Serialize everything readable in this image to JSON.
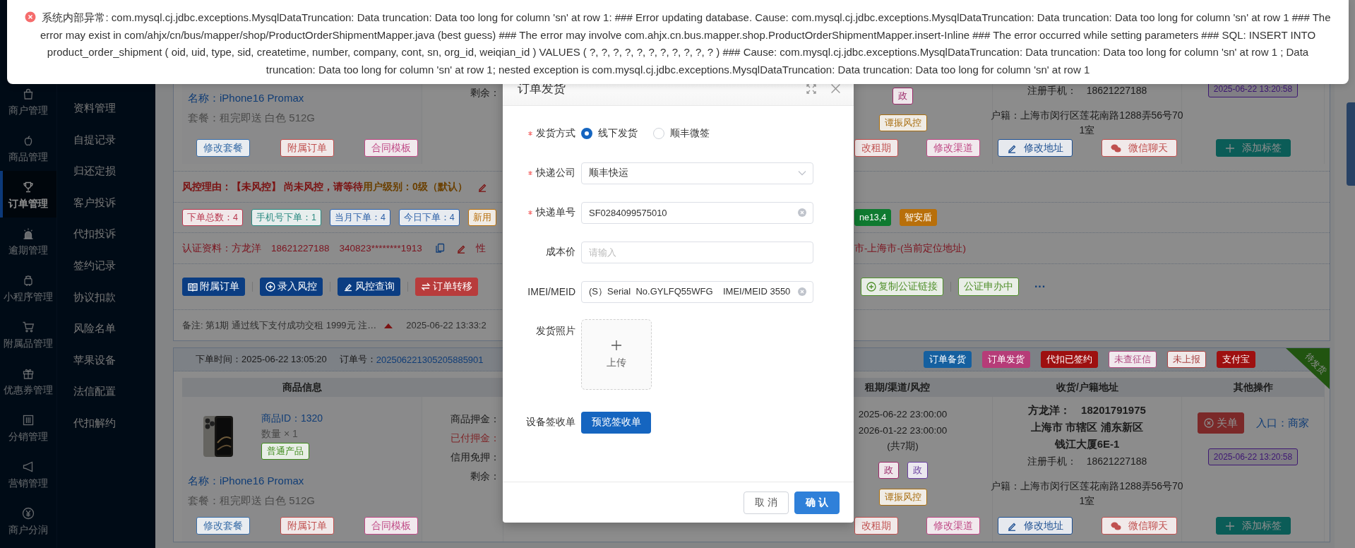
{
  "toast": {
    "kind": "error",
    "message": "系统内部异常: com.mysql.cj.jdbc.exceptions.MysqlDataTruncation: Data truncation: Data too long for column 'sn' at row 1: ### Error updating database. Cause: com.mysql.cj.jdbc.exceptions.MysqlDataTruncation: Data truncation: Data too long for column 'sn' at row 1 ### The error may exist in com/ahjx/cn/bus/mapper/shop/ProductOrderShipmentMapper.java (best guess) ### The error may involve com.ahjx.cn.bus.mapper.shop.ProductOrderShipmentMapper.insert-Inline ### The error occurred while setting parameters ### SQL: INSERT INTO product_order_shipment ( oid, uid, type, sid, createtime, number, company, cont, sn, org_id, weiqian_id ) VALUES ( ?, ?, ?, ?, ?, ?, ?, ?, ?, ?, ? ) ### Cause: com.mysql.cj.jdbc.exceptions.MysqlDataTruncation: Data truncation: Data too long for column 'sn' at row 1 ; Data truncation: Data too long for column 'sn' at row 1; nested exception is com.mysql.cj.jdbc.exceptions.MysqlDataTruncation: Data truncation: Data too long for column 'sn' at row 1"
  },
  "nav": [
    {
      "label": "商户管理",
      "selected": false
    },
    {
      "label": "商品管理",
      "selected": false
    },
    {
      "label": "订单管理",
      "selected": true
    },
    {
      "label": "逾期管理",
      "selected": false
    },
    {
      "label": "小程序管理",
      "selected": false
    },
    {
      "label": "附属品管理",
      "selected": false
    },
    {
      "label": "优惠券管理",
      "selected": false
    },
    {
      "label": "分销管理",
      "selected": false
    },
    {
      "label": "营销管理",
      "selected": false
    },
    {
      "label": "商户分润",
      "selected": false
    }
  ],
  "submenu": [
    "资料管理",
    "自提记录",
    "归还定损",
    "客户投诉",
    "代扣投诉",
    "签约记录",
    "协议扣款",
    "风险名单",
    "苹果设备",
    "法信配置",
    "代扣解约"
  ],
  "orders": [
    {
      "body": {
        "product": {
          "name": "名称：iPhone16 Promax",
          "package": "套餐：租完即送 白色 512G",
          "buttons": [
            {
              "label": "修改套餐",
              "color": "#3a6ea8"
            },
            {
              "label": "附属订单",
              "color": "#c0504f"
            },
            {
              "label": "合同模板",
              "color": "#c04a86"
            }
          ]
        },
        "deposit": [
          {
            "label": "剩余：",
            "kind": "normal"
          }
        ],
        "lease": {
          "tags": [
            {
              "label": "政",
              "color": "#9c2a6a"
            }
          ],
          "risk_tag": {
            "label": "谭振风控",
            "color": "#a86e10"
          },
          "buttons": [
            {
              "label": "改租期",
              "color": "#c0504f"
            },
            {
              "label": "修改渠道",
              "color": "#c04a86"
            }
          ]
        },
        "address": {
          "phone": "注册手机：　18621227188",
          "household": [
            "户籍：上海市闵行区莲花南路1288弄56号70",
            "1室"
          ],
          "buttons": [
            {
              "label": "修改地址",
              "color": "#1d4f91"
            },
            {
              "label": "微信聊天",
              "color": "#c0504f"
            }
          ]
        },
        "ops": {
          "stamp": "2025-06-22 13:20:58",
          "button": "添加标签"
        }
      },
      "risk": {
        "reason": "风控理由：【未风控】 尚未风控，请等待",
        "level": "用户级别：0级（默认）"
      },
      "stats": [
        {
          "label": "下单总数：4",
          "color": "#b8384f"
        },
        {
          "label": "手机号下单：1",
          "color": "#2a8a80"
        },
        {
          "label": "当月下单：4",
          "color": "#2f62a8"
        },
        {
          "label": "今日下单：4",
          "color": "#2f62a8"
        },
        {
          "label": "新用",
          "color": "#b8700e"
        }
      ],
      "stats_right": [
        {
          "label": "ne13,4",
          "color": "#0f7a30",
          "kind": "solid"
        },
        {
          "label": "智安盾",
          "color": "#b86f0a",
          "kind": "solid"
        }
      ],
      "identity": {
        "text": "认证资料：方龙洋　18621227188　340823********1913",
        "cut": "性",
        "location": "市-上海市-(当前定位地址)"
      },
      "actions": [
        {
          "label": "附属订单",
          "kind": "solid",
          "color": "#0b3d82"
        },
        {
          "label": "录入风控",
          "kind": "solid",
          "color": "#0b3d82"
        },
        {
          "label": "风控查询",
          "kind": "solid",
          "color": "#0b3d82"
        },
        {
          "label": "订单转移",
          "kind": "solid",
          "color": "#b83c3c"
        }
      ],
      "actions_right": [
        {
          "label": "复制公证链接",
          "color": "#4f8f2a"
        },
        {
          "label": "公证申办中",
          "color": "#4f8f2a"
        }
      ],
      "more": "···",
      "note": {
        "text": "备注: 第1期 通过线下支付成功交租 1999元 注…",
        "time": "2025-06-22 13:33:2"
      }
    },
    {
      "header": {
        "placed": "下单时间：2025-06-22 13:05:20",
        "order_no_label": "订单号：",
        "order_no": "202506221305205885901",
        "ribbon": "待发货",
        "tags": [
          {
            "label": "订单备货",
            "kind": "solid",
            "color": "#1560a0"
          },
          {
            "label": "订单发货",
            "kind": "solid",
            "color": "#b63c78"
          },
          {
            "label": "代扣已签约",
            "kind": "solid",
            "color": "#9e1010"
          },
          {
            "label": "未查征信",
            "kind": "outline",
            "color": "#b04a80"
          },
          {
            "label": "未上报",
            "kind": "outline",
            "color": "#a84040"
          },
          {
            "label": "支付宝",
            "kind": "solid",
            "color": "#9e1010"
          }
        ]
      },
      "columns": [
        "商品信息",
        "租期/渠道/风控",
        "收货/户籍地址",
        "其他操作"
      ],
      "body": {
        "product": {
          "id": "商品ID：1320",
          "quantity": "数量 × 1",
          "type_tag": {
            "label": "普通产品",
            "color": "#3d8a1a"
          },
          "name": "名称：iPhone16 Promax",
          "package": "套餐：租完即送 白色 512G",
          "buttons": [
            {
              "label": "修改套餐",
              "color": "#3a6ea8"
            },
            {
              "label": "附属订单",
              "color": "#c0504f"
            },
            {
              "label": "合同模板",
              "color": "#c04a86"
            }
          ]
        },
        "deposit": [
          {
            "label": "商品押金：",
            "kind": "normal"
          },
          {
            "label": "已付押金：",
            "kind": "paid"
          },
          {
            "label": "信用免押：",
            "kind": "normal"
          },
          {
            "label": "剩余：",
            "kind": "normal"
          }
        ],
        "lease": {
          "dates": [
            "2025-06-22 23:00:00",
            "2026-01-22 23:00:00",
            "(共7期)"
          ],
          "tags": [
            {
              "label": "政",
              "color": "#9c2a6a"
            },
            {
              "label": "政",
              "color": "#6a3fa0"
            }
          ],
          "risk_tag": {
            "label": "谭振风控",
            "color": "#a86e10"
          },
          "buttons": [
            {
              "label": "改租期",
              "color": "#c0504f"
            },
            {
              "label": "修改渠道",
              "color": "#c04a86"
            }
          ]
        },
        "address": {
          "contact": [
            "方龙洋：　18201791975",
            "上海市 市辖区 浦东新区",
            "钱江大厦6E-1"
          ],
          "phone": "注册手机：　18621227188",
          "household": [
            "户籍：上海市闵行区莲花南路1288弄56号70",
            "1室"
          ],
          "buttons": [
            {
              "label": "修改地址",
              "color": "#1d4f91"
            },
            {
              "label": "微信聊天",
              "color": "#c0504f"
            }
          ]
        },
        "ops": {
          "close_button": "关单",
          "entry": "入口：商家",
          "stamp": "2025-06-22 13:20:58",
          "button": "添加标签"
        }
      }
    }
  ],
  "dialog": {
    "title": "订单发货",
    "fields": [
      {
        "kind": "radio",
        "label": "发货方式",
        "required": true,
        "options": [
          {
            "label": "线下发货",
            "selected": true
          },
          {
            "label": "顺丰微签",
            "selected": false
          }
        ]
      },
      {
        "kind": "select",
        "label": "快递公司",
        "required": true,
        "value": "顺丰快运"
      },
      {
        "kind": "input",
        "label": "快递单号",
        "required": true,
        "value": "SF0284099575010",
        "clearable": true
      },
      {
        "kind": "input",
        "label": "成本价",
        "required": false,
        "placeholder": "请输入"
      },
      {
        "kind": "input",
        "label": "IMEI/MEID",
        "required": false,
        "value": "(S）Serial  No.GYLFQ55WFG    IMEI/MEID 3550",
        "clearable": true
      },
      {
        "kind": "upload",
        "label": "发货照片",
        "required": false,
        "button": "上传"
      },
      {
        "kind": "button",
        "label": "设备签收单",
        "required": false,
        "button": "预览签收单"
      }
    ],
    "cancel": "取 消",
    "confirm": "确 认"
  }
}
